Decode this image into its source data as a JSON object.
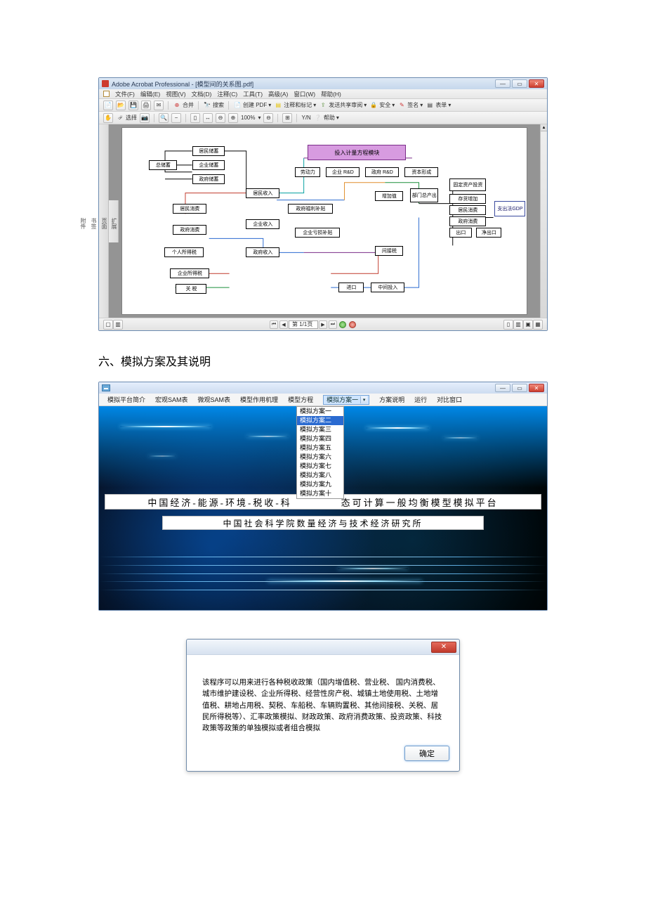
{
  "acrobat": {
    "title": "Adobe Acrobat Professional - [模型间的关系图.pdf]",
    "menu": {
      "file": "文件(F)",
      "edit": "编辑(E)",
      "view": "视图(V)",
      "document": "文档(D)",
      "comment": "注释(C)",
      "tools": "工具(T)",
      "advanced": "高级(A)",
      "window": "窗口(W)",
      "help": "帮助(H)"
    },
    "tb1": {
      "combine": "合并",
      "search": "搜索",
      "create_pdf": "创建 PDF",
      "comments": "注释和标记",
      "send_review": "发送共享审阅",
      "security": "安全",
      "sign": "签名",
      "forms": "表单"
    },
    "tb2": {
      "select": "选择",
      "zoom_val": "100%",
      "yn": "Y/N",
      "help": "帮助"
    },
    "page_indicator": "第 1/1页",
    "side": {
      "a": "页面",
      "b": "书签",
      "c": "附件"
    },
    "side2": {
      "a": "扩展",
      "b": "签名"
    }
  },
  "diagram": {
    "n01": "居民储蓄",
    "n02": "企业储蓄",
    "n03": "政府储蓄",
    "n04": "总储蓄",
    "n05": "居民收入",
    "n06": "劳动力",
    "n07": "企业 R&D",
    "n08": "政府 R&D",
    "n09": "资本形成",
    "n10": "投入计量方程模块",
    "n11": "居民消费",
    "n12": "政府福利补贴",
    "n13": "增加值",
    "n14": "部门总产出",
    "n15": "固定资产投资",
    "n16": "存货增加",
    "n17": "居民消费",
    "n18": "政府消费",
    "n19": "出口",
    "n20": "净出口",
    "n21": "支出法GDP",
    "n22": "政府消费",
    "n23": "企业收入",
    "n24": "企业亏损补贴",
    "n25": "个人所得税",
    "n26": "政府收入",
    "n27": "间接税",
    "n28": "企业所得税",
    "n29": "关 税",
    "n30": "进口",
    "n31": "中间投入"
  },
  "heading": "六、模拟方案及其说明",
  "sim": {
    "menu": {
      "m1": "模拟平台简介",
      "m2": "宏观SAM表",
      "m3": "微观SAM表",
      "m4": "模型作用机理",
      "m5": "模型方程",
      "m6_sel": "模拟方案一",
      "m7": "方案说明",
      "m8": "运行",
      "m9": "对比窗口"
    },
    "options": [
      "模拟方案一",
      "模拟方案二",
      "模拟方案三",
      "模拟方案四",
      "模拟方案五",
      "模拟方案六",
      "模拟方案七",
      "模拟方案八",
      "模拟方案九",
      "模拟方案十"
    ],
    "banner1_pre": "中国经济-能源-环境-税收-科",
    "banner1_post": "态可计算一般均衡模型模拟平台",
    "banner2": "中国社会科学院数量经济与技术经济研究所"
  },
  "dialog": {
    "text": "该程序可以用来进行各种税收政策（国内增值税、营业税、 国内消费税、城市维护建设税、企业所得税、经营性房产税、城镇土地使用税、土地增值税、耕地占用税、契税、车船税、车辆购置税、其他间接税、关税、居民所得税等）、汇率政策模拟、财政政策、政府消费政策、投资政策、科技政策等政策的单独模拟或者组合模拟",
    "ok": "确定"
  }
}
